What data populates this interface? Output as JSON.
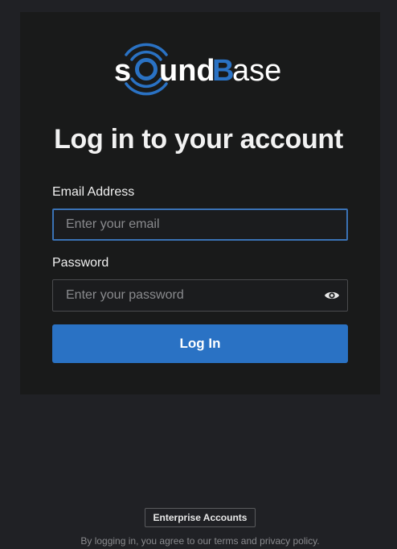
{
  "brand": {
    "logo_text": "sOundBase",
    "logo_part1": "s",
    "logo_part2": "und",
    "logo_part3": "B",
    "logo_part4": "ase",
    "accent_color": "#2a72c4"
  },
  "login": {
    "title": "Log in to your account",
    "email_label": "Email Address",
    "email_placeholder": "Enter your email",
    "email_value": "",
    "password_label": "Password",
    "password_placeholder": "Enter your password",
    "password_value": "",
    "show_password_icon": "eye-icon",
    "submit_label": "Log In"
  },
  "footer": {
    "enterprise_label": "Enterprise Accounts",
    "legal_text": "By logging in, you agree to our terms and privacy policy."
  }
}
